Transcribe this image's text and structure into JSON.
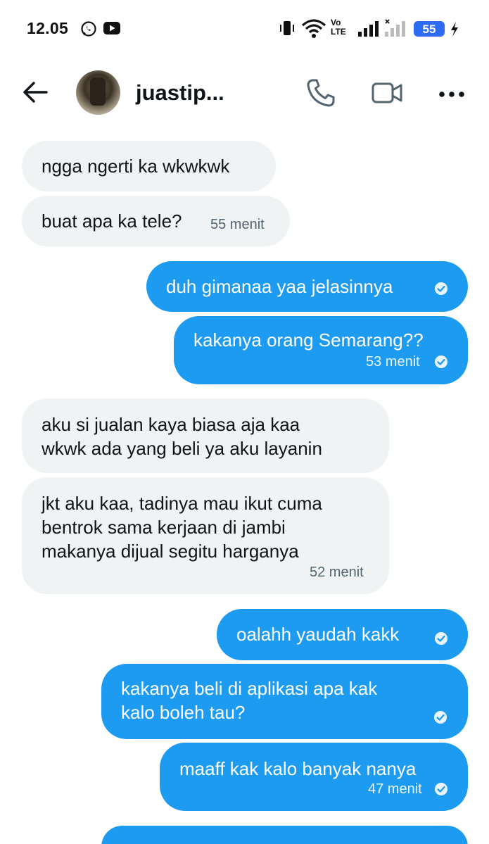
{
  "status_bar": {
    "time": "12.05",
    "app_icons": [
      "whatsapp-icon",
      "youtube-icon"
    ],
    "system_icons": [
      "vibrate-icon",
      "wifi-icon",
      "volte-icon",
      "signal-icon",
      "signal-no-service-icon",
      "charging-icon"
    ],
    "volte_label_top": "Vo",
    "volte_label_bottom": "LTE",
    "battery": "55"
  },
  "header": {
    "contact_name": "juastip...",
    "icons": [
      "back-arrow-icon",
      "phone-icon",
      "video-icon",
      "more-icon"
    ]
  },
  "colors": {
    "outgoing_bubble": "#1d9bf0",
    "incoming_bubble": "#eff3f4",
    "battery": "#2c6cf0"
  },
  "messages": [
    {
      "direction": "incoming",
      "text": "ngga ngerti ka wkwkwk",
      "time": ""
    },
    {
      "direction": "incoming",
      "text": "buat apa ka tele?",
      "time": "55 menit"
    },
    {
      "direction": "outgoing",
      "text": "duh gimanaa yaa jelasinnya",
      "time": ""
    },
    {
      "direction": "outgoing",
      "text": "kakanya orang Semarang??",
      "time": "53 menit"
    },
    {
      "direction": "incoming",
      "text": "aku si jualan kaya biasa aja kaa\nwkwk ada yang beli ya aku layanin",
      "time": ""
    },
    {
      "direction": "incoming",
      "text": "jkt aku kaa, tadinya mau ikut cuma\nbentrok sama kerjaan di jambi\nmakanya dijual segitu harganya",
      "time": "52 menit"
    },
    {
      "direction": "outgoing",
      "text": "oalahh yaudah kakk",
      "time": ""
    },
    {
      "direction": "outgoing",
      "text": "kakanya beli di aplikasi apa kak\nkalo boleh tau?",
      "time": ""
    },
    {
      "direction": "outgoing",
      "text": "maaff kak kalo banyak nanya",
      "time": "47 menit"
    },
    {
      "direction": "outgoing",
      "text": "",
      "time": ""
    }
  ]
}
